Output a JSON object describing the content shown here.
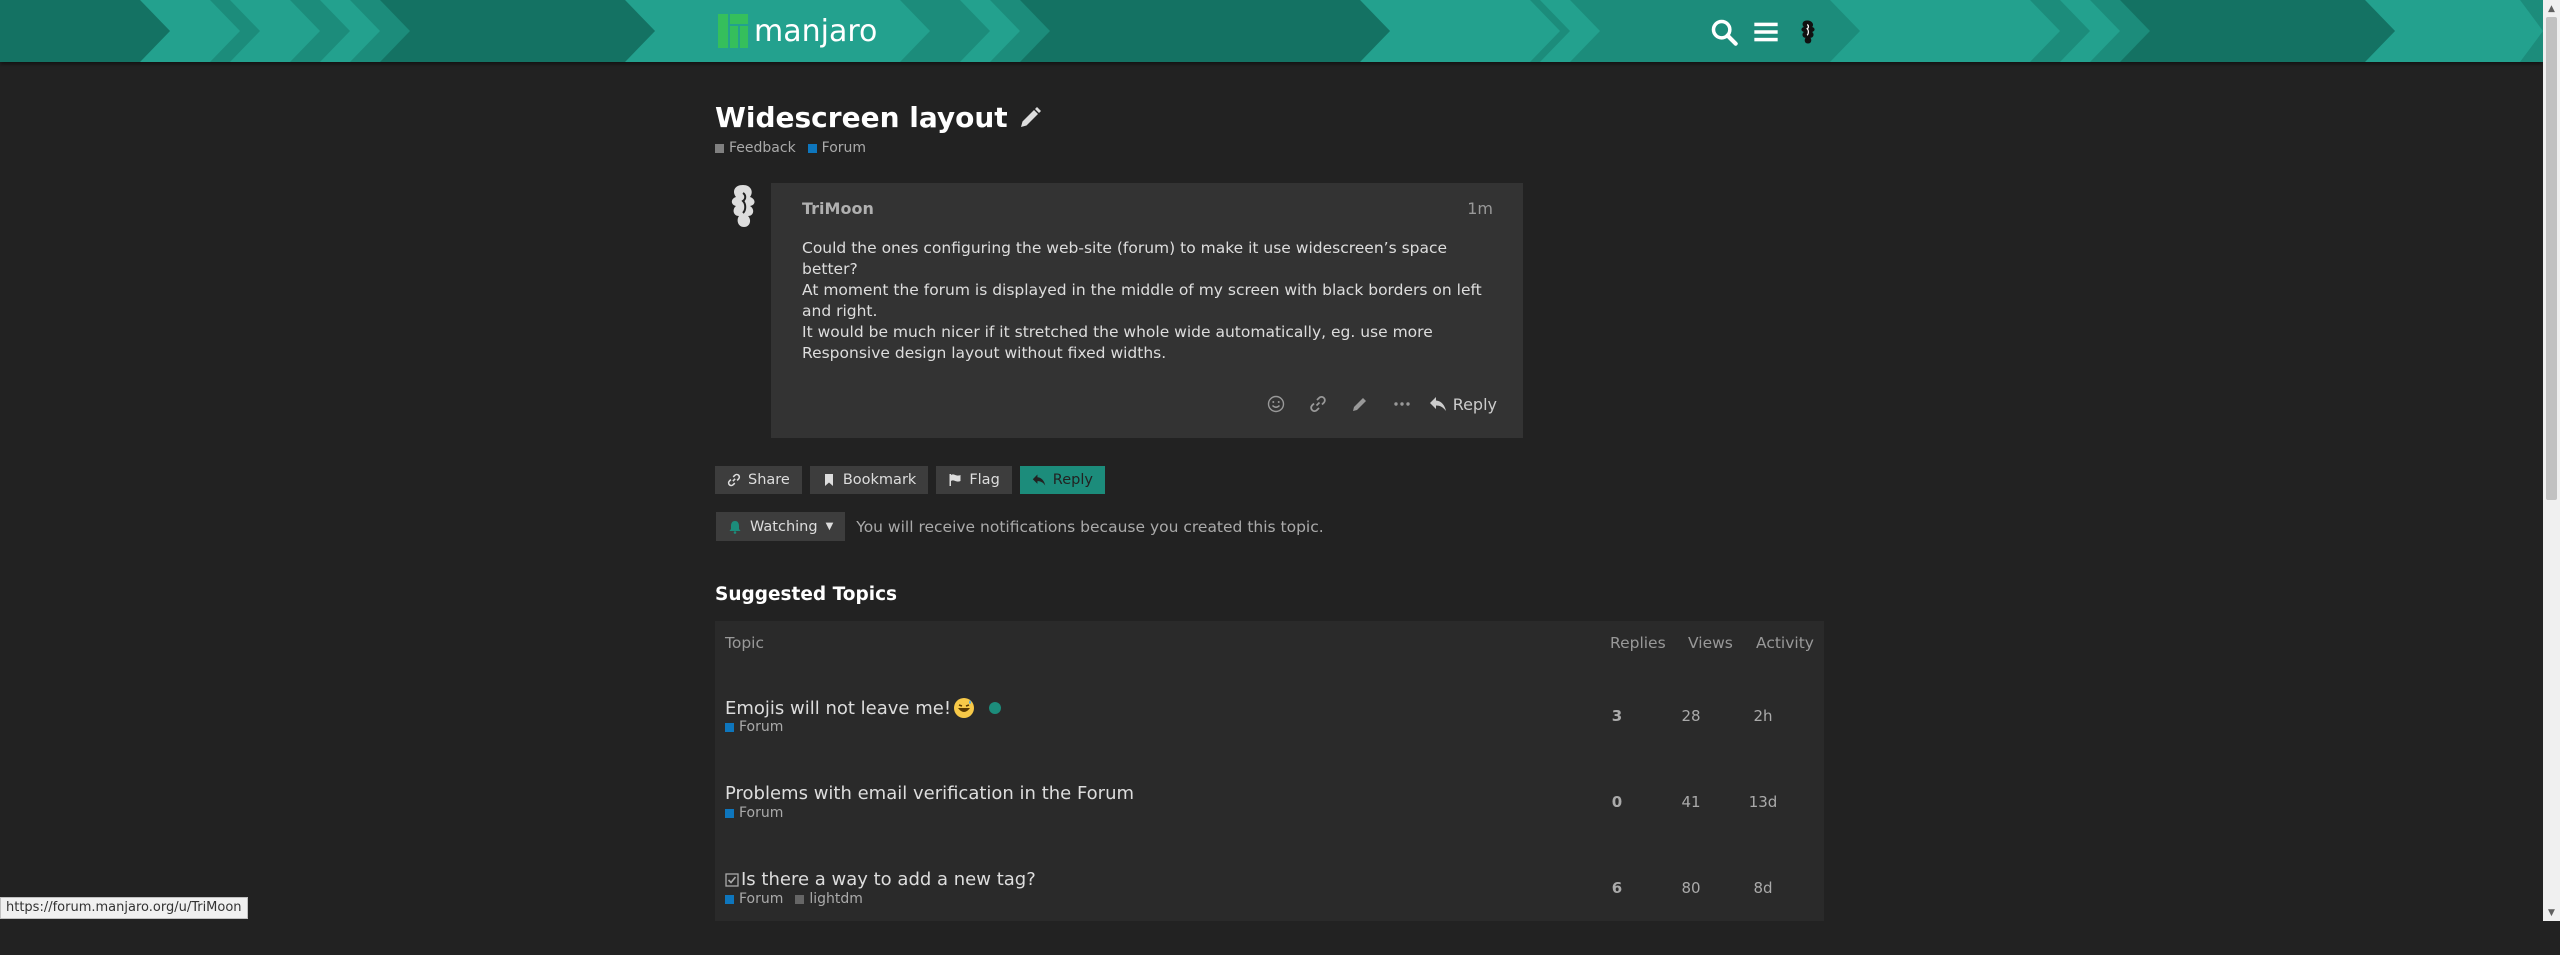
{
  "brand": {
    "name": "manjaro",
    "accent": "#1c8c7b"
  },
  "header": {
    "icons": [
      "search-icon",
      "hamburger-menu-icon",
      "user-avatar"
    ]
  },
  "topic": {
    "title": "Widescreen layout",
    "categories": [
      {
        "name": "Feedback",
        "color": "#808080"
      },
      {
        "name": "Forum",
        "color": "#0e76bd"
      }
    ]
  },
  "post": {
    "username": "TriMoon",
    "time": "1m",
    "lines": [
      "Could the ones configuring the web-site (forum) to make it use widescreen’s space better?",
      "At moment the forum is displayed in the middle of my screen with black borders on left and right.",
      "It would be much nicer if it stretched the whole wide automatically, eg. use more Responsive design layout without fixed widths."
    ],
    "actions": [
      "emoji-icon",
      "link-icon",
      "edit-icon",
      "more-icon"
    ],
    "reply_label": "Reply"
  },
  "footer": {
    "share": "Share",
    "bookmark": "Bookmark",
    "flag": "Flag",
    "reply": "Reply",
    "watching": "Watching",
    "notification_text": "You will receive notifications because you created this topic."
  },
  "suggested": {
    "heading": "Suggested Topics",
    "columns": {
      "topic": "Topic",
      "replies": "Replies",
      "views": "Views",
      "activity": "Activity"
    },
    "rows": [
      {
        "title": "Emojis will not leave me!",
        "category": "Forum",
        "tag": "",
        "replies": "3",
        "views": "28",
        "activity": "2h"
      },
      {
        "title": "Problems with email verification in the Forum",
        "category": "Forum",
        "tag": "",
        "replies": "0",
        "views": "41",
        "activity": "13d"
      },
      {
        "title": "Is there a way to add a new tag?",
        "category": "Forum",
        "tag": "lightdm",
        "replies": "6",
        "views": "80",
        "activity": "8d"
      }
    ]
  },
  "status_bar": {
    "url": "https://forum.manjaro.org/u/TriMoon"
  }
}
